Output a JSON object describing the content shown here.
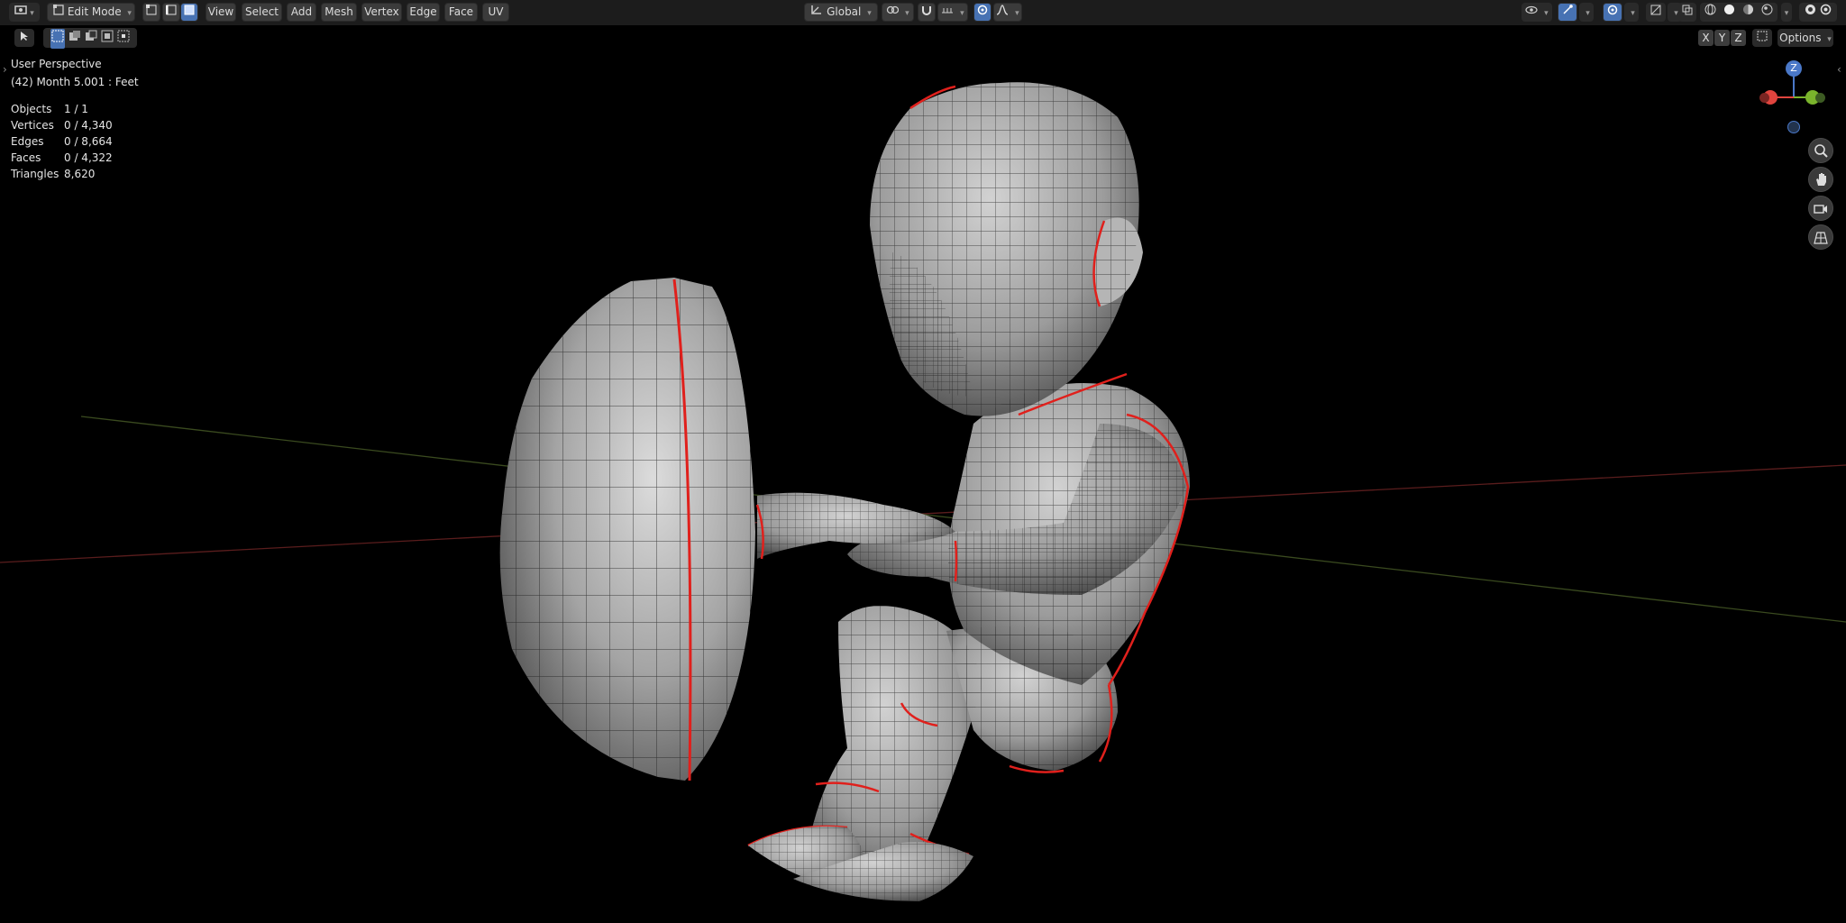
{
  "header": {
    "mode_label": "Edit Mode",
    "menus": [
      "View",
      "Select",
      "Add",
      "Mesh",
      "Vertex",
      "Edge",
      "Face",
      "UV"
    ],
    "transform_orientation": "Global",
    "options_label": "Options",
    "axis_toggles": [
      "X",
      "Y",
      "Z"
    ]
  },
  "viewport": {
    "view_name": "User Perspective",
    "object_info": "(42) Month 5.001 : Feet",
    "stats": [
      {
        "label": "Objects",
        "value": "1 / 1"
      },
      {
        "label": "Vertices",
        "value": "0 / 4,340"
      },
      {
        "label": "Edges",
        "value": "0 / 8,664"
      },
      {
        "label": "Faces",
        "value": "0 / 4,322"
      },
      {
        "label": "Triangles",
        "value": "8,620"
      }
    ]
  },
  "gizmo": {
    "z_label": "Z",
    "colors": {
      "x": "#e0443e",
      "y": "#7ab42c",
      "z": "#4a78c8"
    }
  },
  "colors": {
    "header_bg": "#1c1c1c",
    "button_bg": "#3b3b3b",
    "accent_blue": "#4772b3",
    "viewport_bg": "#000000",
    "seam_red": "#e0201c",
    "mesh_fill": "#9a9a9a"
  }
}
